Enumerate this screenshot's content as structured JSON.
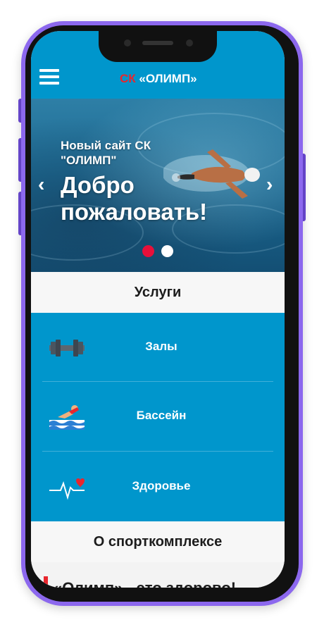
{
  "header": {
    "logo_prefix": "СК",
    "logo_name": "«ОЛИМП»"
  },
  "hero": {
    "subtitle": "Новый сайт СК \"ОЛИМП\"",
    "title": "Добро пожаловать!",
    "prev_arrow": "‹",
    "next_arrow": "›",
    "slides_count": 2,
    "active_slide": 1
  },
  "sections": {
    "services_title": "Услуги",
    "about_title": "О спорткомплексе"
  },
  "services": [
    {
      "label": "Залы",
      "icon": "dumbbell-icon"
    },
    {
      "label": "Бассейн",
      "icon": "swimmer-icon"
    },
    {
      "label": "Здоровье",
      "icon": "heartbeat-icon"
    }
  ],
  "about": {
    "headline": "«Олимп» - это здорово!"
  },
  "colors": {
    "brand_blue": "#0096cc",
    "accent_red": "#e8262d",
    "frame_purple": "#8c68ee"
  }
}
